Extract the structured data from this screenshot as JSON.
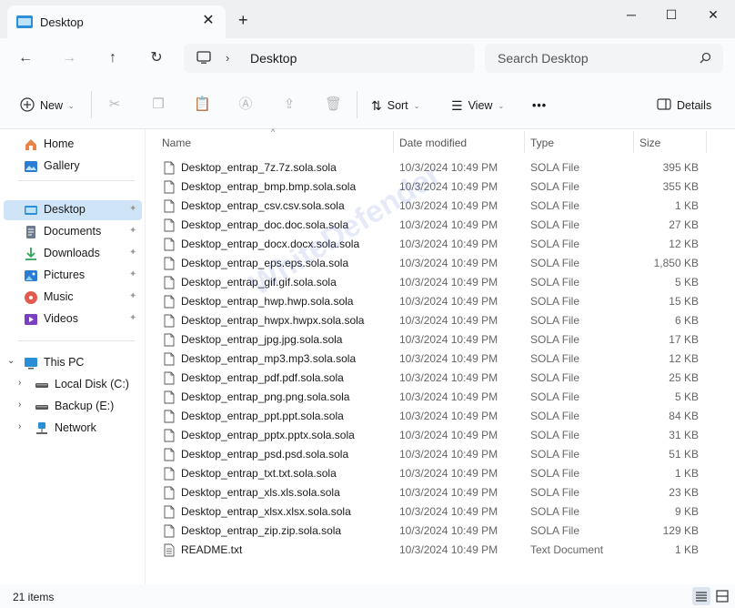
{
  "window": {
    "tab_title": "Desktop",
    "new_tab_glyph": "+",
    "close_tab_glyph": "✕",
    "minimize_glyph": "─",
    "maximize_glyph": "☐",
    "close_glyph": "✕"
  },
  "nav": {
    "back_glyph": "←",
    "forward_glyph": "→",
    "up_glyph": "↑",
    "refresh_glyph": "↻",
    "breadcrumb_sep": "›",
    "breadcrumb": "Desktop",
    "search_placeholder": "Search Desktop"
  },
  "toolbar": {
    "new_label": "New",
    "sort_label": "Sort",
    "view_label": "View",
    "more_label": "•••",
    "details_label": "Details"
  },
  "sidebar": {
    "items": [
      {
        "label": "Home",
        "icon": "home-icon"
      },
      {
        "label": "Gallery",
        "icon": "gallery-icon"
      },
      {
        "label": "Desktop",
        "icon": "desktop-folder-icon",
        "selected": true,
        "pinned": true
      },
      {
        "label": "Documents",
        "icon": "documents-icon",
        "pinned": true
      },
      {
        "label": "Downloads",
        "icon": "downloads-icon",
        "pinned": true
      },
      {
        "label": "Pictures",
        "icon": "pictures-icon",
        "pinned": true
      },
      {
        "label": "Music",
        "icon": "music-icon",
        "pinned": true
      },
      {
        "label": "Videos",
        "icon": "videos-icon",
        "pinned": true
      },
      {
        "label": "This PC",
        "icon": "this-pc-icon",
        "expanded": true
      },
      {
        "label": "Local Disk (C:)",
        "icon": "drive-icon"
      },
      {
        "label": "Backup (E:)",
        "icon": "drive-icon"
      },
      {
        "label": "Network",
        "icon": "network-icon"
      }
    ],
    "pin_glyph": "📌"
  },
  "columns": {
    "name": "Name",
    "date": "Date modified",
    "type": "Type",
    "size": "Size"
  },
  "files": [
    {
      "name": "Desktop_entrap_7z.7z.sola.sola",
      "date": "10/3/2024 10:49 PM",
      "type": "SOLA File",
      "size": "395 KB"
    },
    {
      "name": "Desktop_entrap_bmp.bmp.sola.sola",
      "date": "10/3/2024 10:49 PM",
      "type": "SOLA File",
      "size": "355 KB"
    },
    {
      "name": "Desktop_entrap_csv.csv.sola.sola",
      "date": "10/3/2024 10:49 PM",
      "type": "SOLA File",
      "size": "1 KB"
    },
    {
      "name": "Desktop_entrap_doc.doc.sola.sola",
      "date": "10/3/2024 10:49 PM",
      "type": "SOLA File",
      "size": "27 KB"
    },
    {
      "name": "Desktop_entrap_docx.docx.sola.sola",
      "date": "10/3/2024 10:49 PM",
      "type": "SOLA File",
      "size": "12 KB"
    },
    {
      "name": "Desktop_entrap_eps.eps.sola.sola",
      "date": "10/3/2024 10:49 PM",
      "type": "SOLA File",
      "size": "1,850 KB"
    },
    {
      "name": "Desktop_entrap_gif.gif.sola.sola",
      "date": "10/3/2024 10:49 PM",
      "type": "SOLA File",
      "size": "5 KB"
    },
    {
      "name": "Desktop_entrap_hwp.hwp.sola.sola",
      "date": "10/3/2024 10:49 PM",
      "type": "SOLA File",
      "size": "15 KB"
    },
    {
      "name": "Desktop_entrap_hwpx.hwpx.sola.sola",
      "date": "10/3/2024 10:49 PM",
      "type": "SOLA File",
      "size": "6 KB"
    },
    {
      "name": "Desktop_entrap_jpg.jpg.sola.sola",
      "date": "10/3/2024 10:49 PM",
      "type": "SOLA File",
      "size": "17 KB"
    },
    {
      "name": "Desktop_entrap_mp3.mp3.sola.sola",
      "date": "10/3/2024 10:49 PM",
      "type": "SOLA File",
      "size": "12 KB"
    },
    {
      "name": "Desktop_entrap_pdf.pdf.sola.sola",
      "date": "10/3/2024 10:49 PM",
      "type": "SOLA File",
      "size": "25 KB"
    },
    {
      "name": "Desktop_entrap_png.png.sola.sola",
      "date": "10/3/2024 10:49 PM",
      "type": "SOLA File",
      "size": "5 KB"
    },
    {
      "name": "Desktop_entrap_ppt.ppt.sola.sola",
      "date": "10/3/2024 10:49 PM",
      "type": "SOLA File",
      "size": "84 KB"
    },
    {
      "name": "Desktop_entrap_pptx.pptx.sola.sola",
      "date": "10/3/2024 10:49 PM",
      "type": "SOLA File",
      "size": "31 KB"
    },
    {
      "name": "Desktop_entrap_psd.psd.sola.sola",
      "date": "10/3/2024 10:49 PM",
      "type": "SOLA File",
      "size": "51 KB"
    },
    {
      "name": "Desktop_entrap_txt.txt.sola.sola",
      "date": "10/3/2024 10:49 PM",
      "type": "SOLA File",
      "size": "1 KB"
    },
    {
      "name": "Desktop_entrap_xls.xls.sola.sola",
      "date": "10/3/2024 10:49 PM",
      "type": "SOLA File",
      "size": "23 KB"
    },
    {
      "name": "Desktop_entrap_xlsx.xlsx.sola.sola",
      "date": "10/3/2024 10:49 PM",
      "type": "SOLA File",
      "size": "9 KB"
    },
    {
      "name": "Desktop_entrap_zip.zip.sola.sola",
      "date": "10/3/2024 10:49 PM",
      "type": "SOLA File",
      "size": "129 KB"
    },
    {
      "name": "README.txt",
      "date": "10/3/2024 10:49 PM",
      "type": "Text Document",
      "size": "1 KB"
    }
  ],
  "status": {
    "item_count": "21 items"
  },
  "watermark": "WhiteDefender",
  "colors": {
    "selection": "#cfe4f7",
    "accent": "#0067c0",
    "chrome": "#eef0f2"
  }
}
